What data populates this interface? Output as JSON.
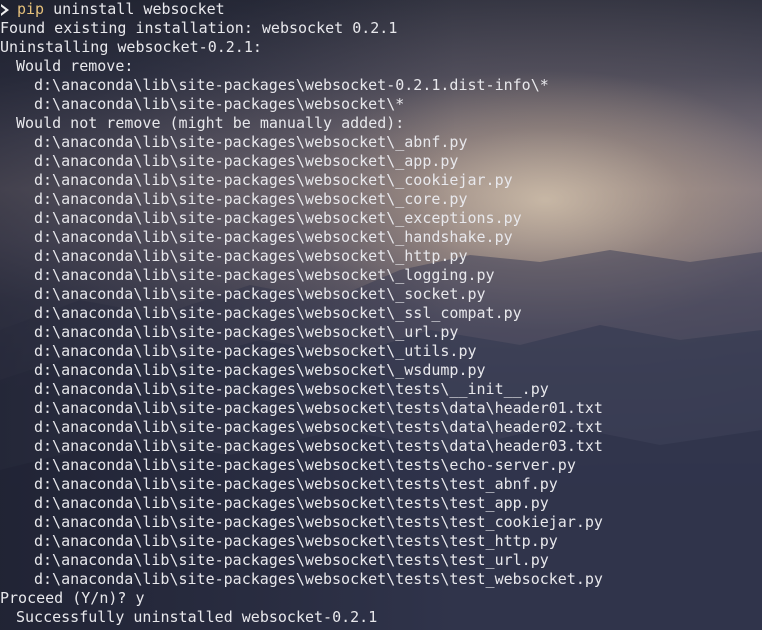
{
  "colors": {
    "command_accent": "#e5c07b",
    "text": "#e8e8ec",
    "prompt_chevron": "#f0f0f0"
  },
  "icons": {
    "prompt": "chevron-right-icon"
  },
  "terminal": {
    "prompt": {
      "command": "pip",
      "args": " uninstall websocket"
    },
    "found_line": "Found existing installation: websocket 0.2.1",
    "uninstalling_line": "Uninstalling websocket-0.2.1:",
    "would_remove_header": "Would remove:",
    "would_remove": [
      "d:\\anaconda\\lib\\site-packages\\websocket-0.2.1.dist-info\\*",
      "d:\\anaconda\\lib\\site-packages\\websocket\\*"
    ],
    "would_not_remove_header": "Would not remove (might be manually added):",
    "would_not_remove": [
      "d:\\anaconda\\lib\\site-packages\\websocket\\_abnf.py",
      "d:\\anaconda\\lib\\site-packages\\websocket\\_app.py",
      "d:\\anaconda\\lib\\site-packages\\websocket\\_cookiejar.py",
      "d:\\anaconda\\lib\\site-packages\\websocket\\_core.py",
      "d:\\anaconda\\lib\\site-packages\\websocket\\_exceptions.py",
      "d:\\anaconda\\lib\\site-packages\\websocket\\_handshake.py",
      "d:\\anaconda\\lib\\site-packages\\websocket\\_http.py",
      "d:\\anaconda\\lib\\site-packages\\websocket\\_logging.py",
      "d:\\anaconda\\lib\\site-packages\\websocket\\_socket.py",
      "d:\\anaconda\\lib\\site-packages\\websocket\\_ssl_compat.py",
      "d:\\anaconda\\lib\\site-packages\\websocket\\_url.py",
      "d:\\anaconda\\lib\\site-packages\\websocket\\_utils.py",
      "d:\\anaconda\\lib\\site-packages\\websocket\\_wsdump.py",
      "d:\\anaconda\\lib\\site-packages\\websocket\\tests\\__init__.py",
      "d:\\anaconda\\lib\\site-packages\\websocket\\tests\\data\\header01.txt",
      "d:\\anaconda\\lib\\site-packages\\websocket\\tests\\data\\header02.txt",
      "d:\\anaconda\\lib\\site-packages\\websocket\\tests\\data\\header03.txt",
      "d:\\anaconda\\lib\\site-packages\\websocket\\tests\\echo-server.py",
      "d:\\anaconda\\lib\\site-packages\\websocket\\tests\\test_abnf.py",
      "d:\\anaconda\\lib\\site-packages\\websocket\\tests\\test_app.py",
      "d:\\anaconda\\lib\\site-packages\\websocket\\tests\\test_cookiejar.py",
      "d:\\anaconda\\lib\\site-packages\\websocket\\tests\\test_http.py",
      "d:\\anaconda\\lib\\site-packages\\websocket\\tests\\test_url.py",
      "d:\\anaconda\\lib\\site-packages\\websocket\\tests\\test_websocket.py"
    ],
    "proceed_line": "Proceed (Y/n)? y",
    "success_line": "Successfully uninstalled websocket-0.2.1"
  }
}
